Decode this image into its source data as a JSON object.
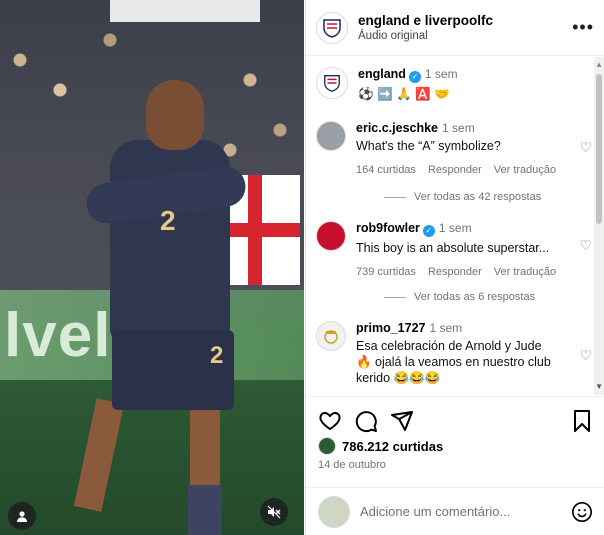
{
  "header": {
    "title": "england e liverpoolfc",
    "subtitle": "Áudio original"
  },
  "media": {
    "board_text": "lvelun",
    "shirt_number": "2"
  },
  "caption": {
    "username": "england",
    "time": "1 sem",
    "emojis": "⚽ ➡️ 🙏 🅰️ 🤝"
  },
  "comments": [
    {
      "username": "eric.c.jeschke",
      "time": "1 sem",
      "verified": false,
      "text": "What's the “A” symbolize?",
      "likes": "164 curtidas",
      "reply": "Responder",
      "translate": "Ver tradução",
      "view_replies": "Ver todas as 42 respostas"
    },
    {
      "username": "rob9fowler",
      "time": "1 sem",
      "verified": true,
      "text": "This boy is an absolute superstar...",
      "likes": "739 curtidas",
      "reply": "Responder",
      "translate": "Ver tradução",
      "view_replies": "Ver todas as 6 respostas"
    },
    {
      "username": "primo_1727",
      "time": "1 sem",
      "verified": false,
      "text": "Esa celebración de Arnold y Jude 🔥 ojalá la veamos en nuestro club kerido 😂😂😂"
    }
  ],
  "actions": {
    "likes": "786.212 curtidas",
    "date": "14 de outubro"
  },
  "add_comment": {
    "placeholder": "Adicione um comentário..."
  },
  "colors": {
    "verified": "#1d9bf0",
    "muted_text": "#737373"
  }
}
